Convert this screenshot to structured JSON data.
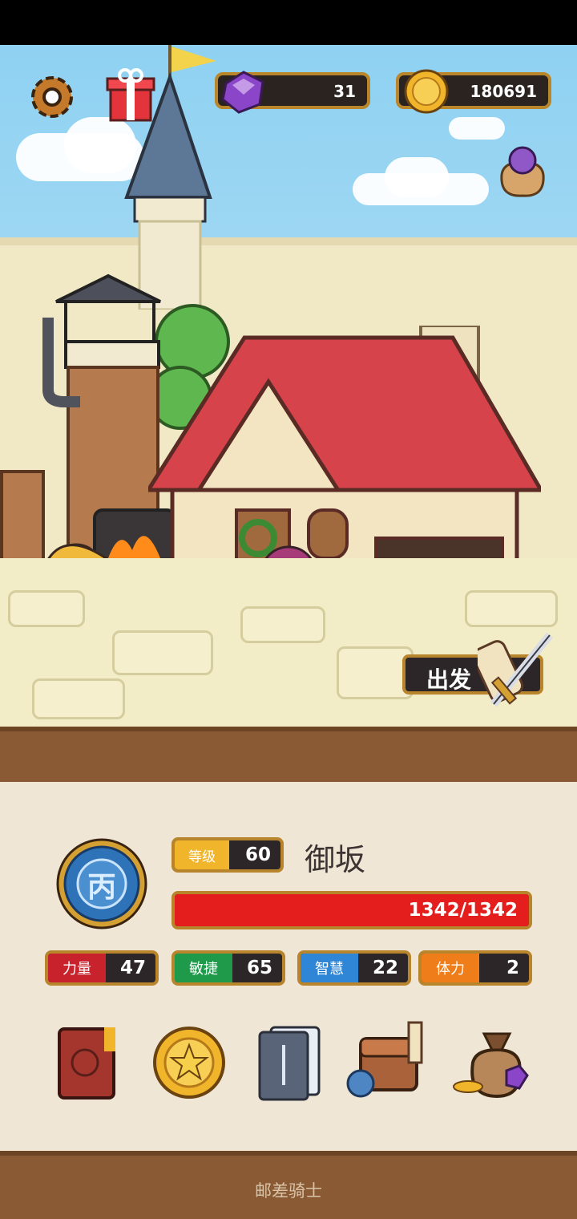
{
  "hud": {
    "gems": "31",
    "gold": "180691"
  },
  "scene": {
    "depart_label": "出发"
  },
  "hero": {
    "rank_glyph": "丙",
    "level_label": "等级",
    "level": "60",
    "name": "御坂",
    "hp_text": "1342/1342",
    "hp_fraction": 1.0
  },
  "stats": [
    {
      "label": "力量",
      "value": "47",
      "color": "#c8232c"
    },
    {
      "label": "敏捷",
      "value": "65",
      "color": "#1f9a4a"
    },
    {
      "label": "智慧",
      "value": "22",
      "color": "#2f86d6"
    },
    {
      "label": "体力",
      "value": "2",
      "color": "#ef7d1a"
    }
  ],
  "menu_icons": [
    "hero-book-icon",
    "gold-coin-icon",
    "card-deck-icon",
    "inventory-backpack-icon",
    "treasure-bag-icon"
  ],
  "footer": {
    "game_title": "邮差骑士"
  },
  "colors": {
    "hp_red": "#e41d1d",
    "frame_gold": "#b8842c",
    "gem_purple": "#8b45c9",
    "coin_gold": "#f0b52a"
  }
}
